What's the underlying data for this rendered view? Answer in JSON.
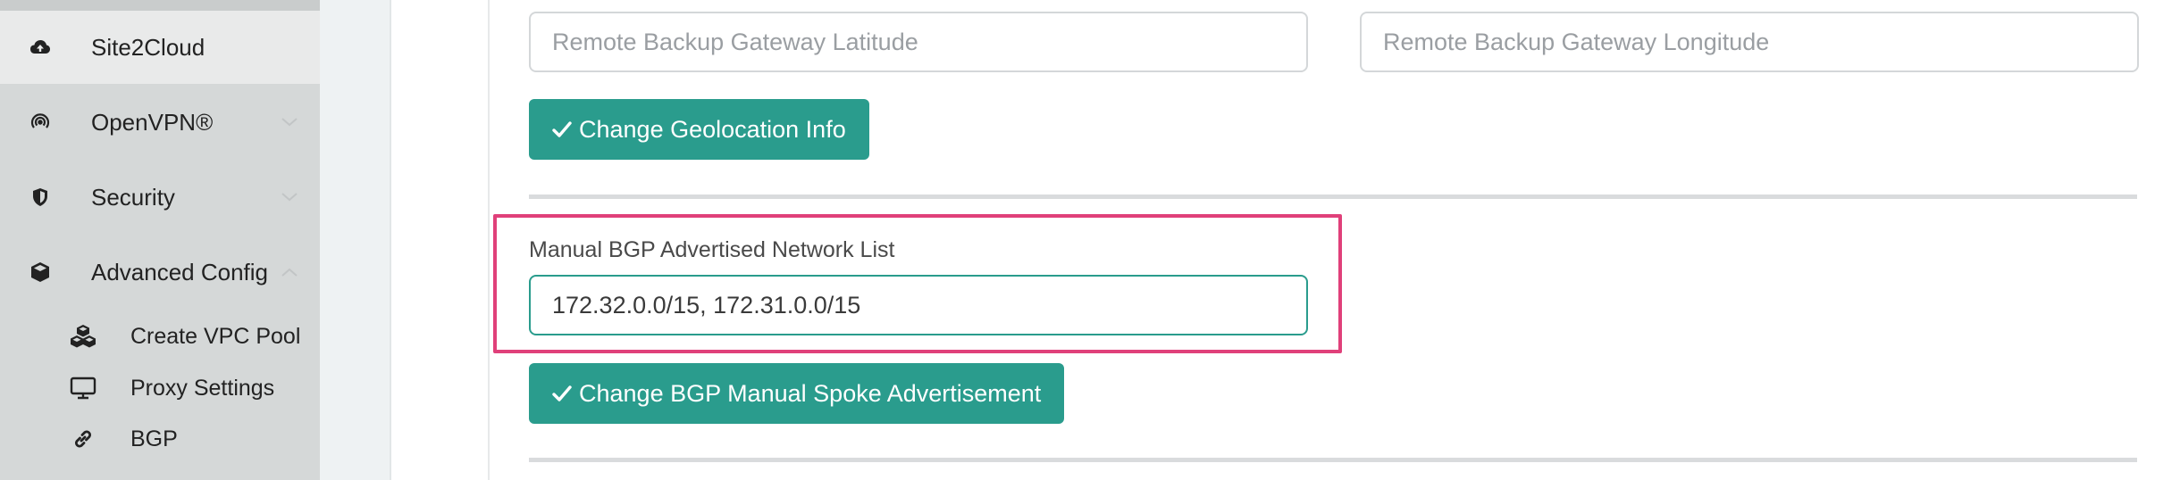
{
  "sidebar": {
    "items": [
      {
        "label": "Site2Cloud",
        "icon": "cloud-upload-icon",
        "active": true
      },
      {
        "label": "OpenVPN®",
        "icon": "wireless-signal-icon",
        "expandable": true
      },
      {
        "label": "Security",
        "icon": "shield-icon",
        "expandable": true
      },
      {
        "label": "Advanced Config",
        "icon": "cube-icon",
        "expanded": true
      }
    ],
    "subitems": [
      {
        "label": "Create VPC Pool",
        "icon": "cubes-icon"
      },
      {
        "label": "Proxy Settings",
        "icon": "monitor-icon"
      },
      {
        "label": "BGP",
        "icon": "link-icon"
      }
    ]
  },
  "geolocation": {
    "latitude_placeholder": "Remote Backup Gateway Latitude",
    "longitude_placeholder": "Remote Backup Gateway Longitude",
    "button_label": "Change Geolocation Info"
  },
  "bgp": {
    "field_label": "Manual BGP Advertised Network List",
    "field_value": "172.32.0.0/15, 172.31.0.0/15",
    "button_label": "Change BGP Manual Spoke Advertisement"
  },
  "colors": {
    "accent": "#2a9c8d",
    "highlight": "#e0407a",
    "sidebar_bg": "#d5d8d8"
  }
}
